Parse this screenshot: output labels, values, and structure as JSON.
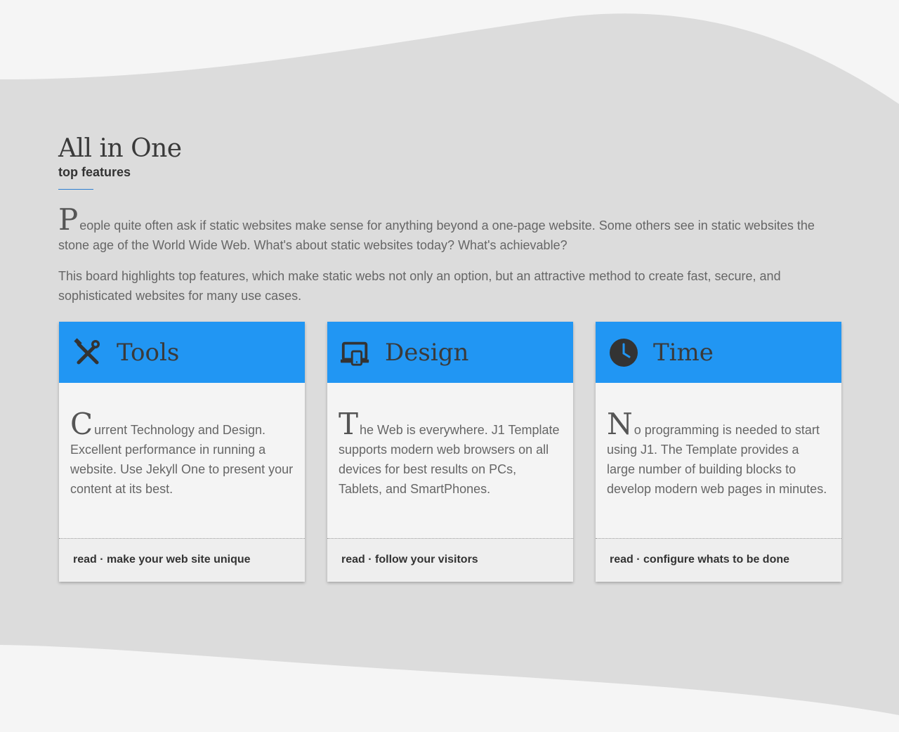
{
  "section": {
    "title": "All in One",
    "subtitle": "top features",
    "intro_first": {
      "dropcap": "P",
      "text": "eople quite often ask if static websites make sense for anything beyond a one-page website. Some others see in static websites the stone age of the World Wide Web. What's about static websites today? What's achievable?"
    },
    "intro_second": "This board highlights top features, which make static webs not only an option, but an attractive method to create fast, secure, and sophisticated websites for many use cases."
  },
  "cards": [
    {
      "icon": "tools-icon",
      "title": "Tools",
      "dropcap": "C",
      "text": "urrent Technology and Design. Excellent performance in running a website. Use Jekyll One to present your content at its best.",
      "link": "read · make your web site unique"
    },
    {
      "icon": "devices-icon",
      "title": "Design",
      "dropcap": "T",
      "text": "he Web is everywhere. J1 Template supports modern web browsers on all devices for best results on PCs, Tablets, and SmartPhones.",
      "link": "read · follow your visitors"
    },
    {
      "icon": "clock-icon",
      "title": "Time",
      "dropcap": "N",
      "text": "o programming is needed to start using J1. The Template provides a large number of building blocks to develop modern web pages in minutes.",
      "link": "read · configure whats to be done"
    }
  ],
  "colors": {
    "accent": "#2196f3",
    "band": "#dcdcdc",
    "page": "#f5f5f5"
  }
}
